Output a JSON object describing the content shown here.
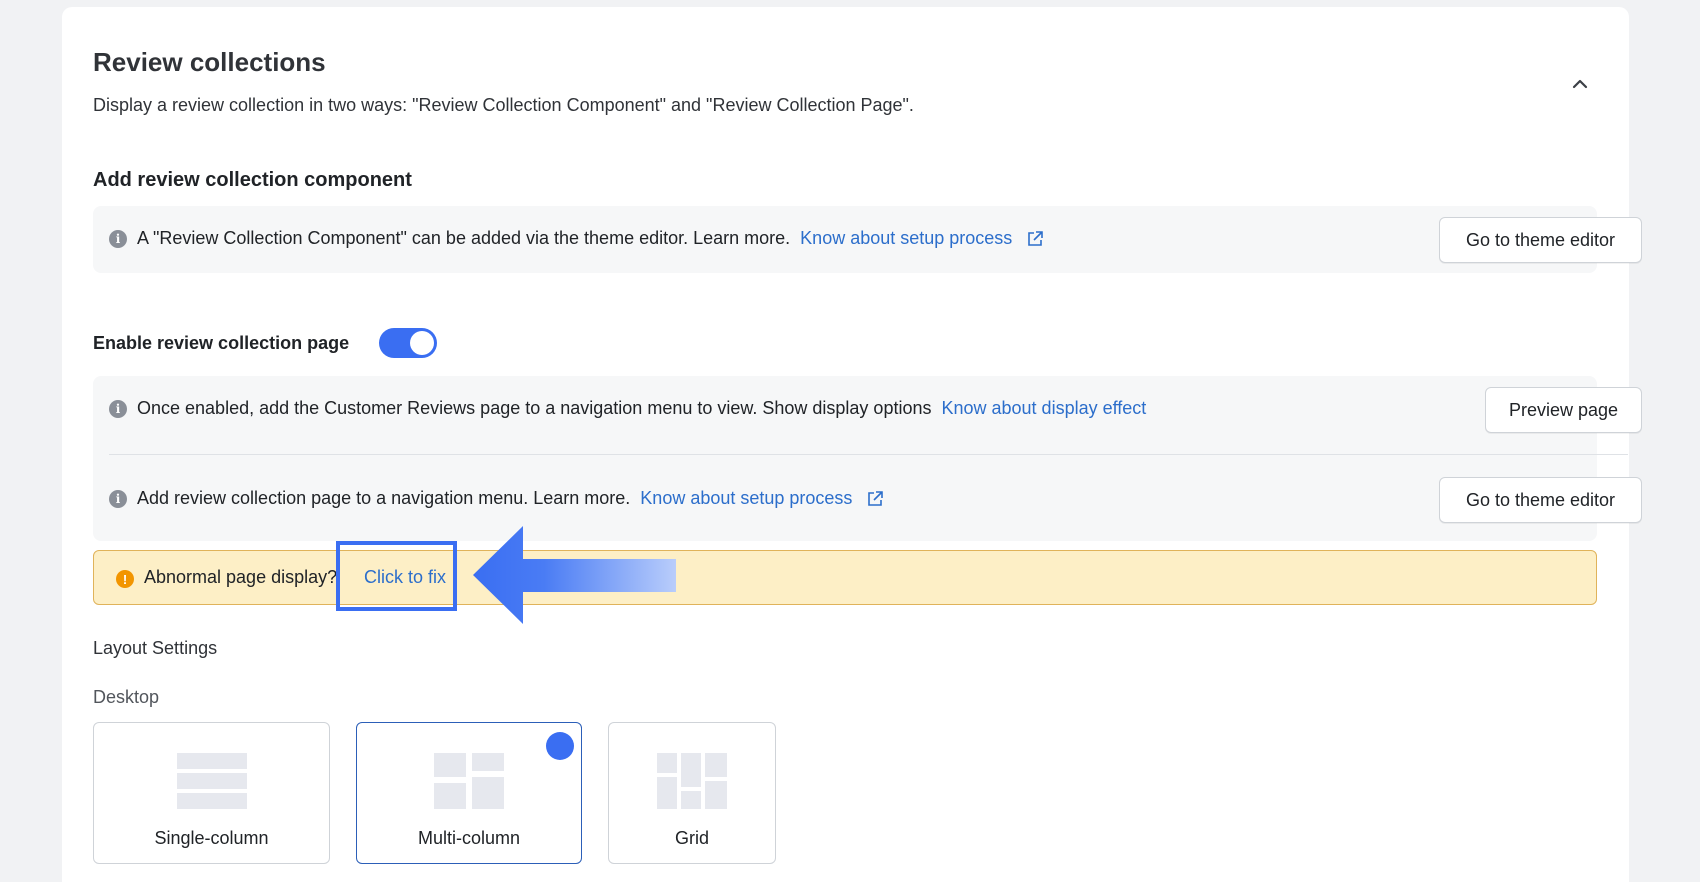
{
  "section": {
    "title": "Review collections",
    "description": "Display a review collection in two ways: \"Review Collection Component\" and \"Review Collection Page\"."
  },
  "component": {
    "heading": "Add review collection component",
    "info_text": "A \"Review Collection Component\" can be added via the theme editor. Learn more.",
    "link_text": "Know about setup process",
    "button_label": "Go to theme editor"
  },
  "page_toggle": {
    "label": "Enable review collection page",
    "enabled": true
  },
  "page_info": {
    "row1_text": "Once enabled, add the Customer Reviews page to a navigation menu to view. Show display options",
    "row1_link": "Know about display effect",
    "row1_button": "Preview page",
    "row2_text": "Add review collection page to a navigation menu. Learn more.",
    "row2_link": "Know about setup process",
    "row2_button": "Go to theme editor"
  },
  "warning": {
    "text": "Abnormal page display?",
    "fix_link": "Click to fix"
  },
  "layout": {
    "heading": "Layout Settings",
    "device_label": "Desktop",
    "options": [
      {
        "label": "Single-column",
        "selected": false
      },
      {
        "label": "Multi-column",
        "selected": true
      },
      {
        "label": "Grid",
        "selected": false
      }
    ]
  },
  "colors": {
    "accent": "#3a6ef2",
    "link": "#2c6ecb",
    "warning_bg": "#fdefc6",
    "warning_border": "#e0b35a",
    "warning_icon": "#f29500"
  },
  "icons": [
    "chevron-up-icon",
    "info-icon",
    "external-link-icon",
    "warning-icon",
    "checkmark-icon",
    "arrow-pointer-icon"
  ]
}
